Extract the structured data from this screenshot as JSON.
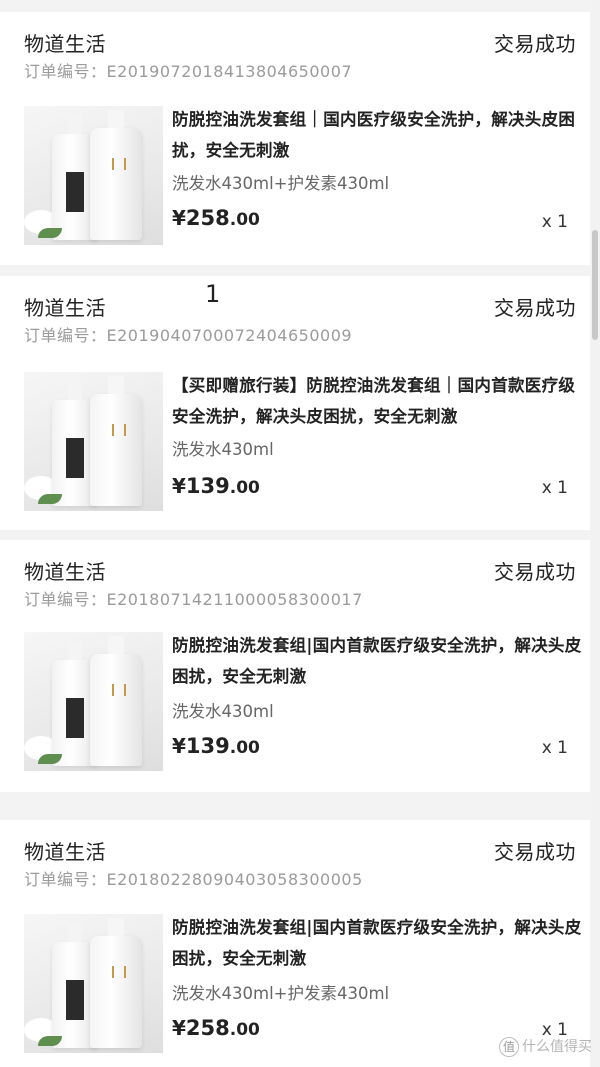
{
  "orders": [
    {
      "shop": "物道生活",
      "status": "交易成功",
      "order_no": "订单编号：E2019072018413804650007",
      "title": "防脱控油洗发套组｜国内医疗级安全洗护，解决头皮困扰，安全无刺激",
      "spec": "洗发水430ml+护发素430ml",
      "price_currency": "¥",
      "price_int": "258",
      "price_dec": ".00",
      "qty": "x 1"
    },
    {
      "shop": "物道生活",
      "status": "交易成功",
      "order_no": "订单编号：E2019040700072404650009",
      "title": "【买即赠旅行装】防脱控油洗发套组｜国内首款医疗级安全洗护，解决头皮困扰，安全无刺激",
      "spec": "洗发水430ml",
      "price_currency": "¥",
      "price_int": "139",
      "price_dec": ".00",
      "qty": "x 1"
    },
    {
      "shop": "物道生活",
      "status": "交易成功",
      "order_no": "订单编号：E20180714211000058300017",
      "title": "防脱控油洗发套组|国内首款医疗级安全洗护，解决头皮困扰，安全无刺激",
      "spec": "洗发水430ml",
      "price_currency": "¥",
      "price_int": "139",
      "price_dec": ".00",
      "qty": "x 1"
    },
    {
      "shop": "物道生活",
      "status": "交易成功",
      "order_no": "订单编号：E20180228090403058300005",
      "title": "防脱控油洗发套组|国内首款医疗级安全洗护，解决头皮困扰，安全无刺激",
      "spec": "洗发水430ml+护发素430ml",
      "price_currency": "¥",
      "price_int": "258",
      "price_dec": ".00",
      "qty": "x 1"
    }
  ],
  "annotation": "1",
  "watermark": {
    "badge": "值",
    "text": "什么值得买"
  }
}
